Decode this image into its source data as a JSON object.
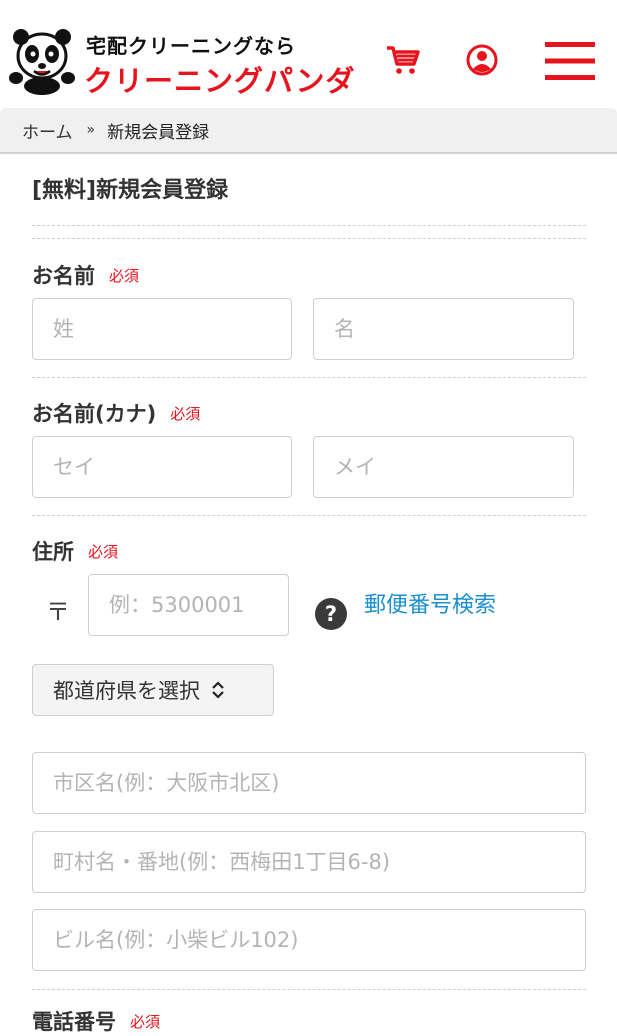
{
  "header": {
    "logo_sub": "宅配クリーニングなら",
    "logo_main": "クリーニングパンダ",
    "brand_color": "#e8141d",
    "icons": {
      "cart": "cart-icon",
      "user": "user-icon",
      "menu": "hamburger-menu-icon"
    }
  },
  "breadcrumb": {
    "home": "ホーム",
    "separator": "»",
    "current": "新規会員登録"
  },
  "form": {
    "title": "[無料]新規会員登録",
    "required_label": "必須",
    "name": {
      "label": "お名前",
      "last_placeholder": "姓",
      "first_placeholder": "名"
    },
    "kana": {
      "label": "お名前(カナ)",
      "last_placeholder": "セイ",
      "first_placeholder": "メイ"
    },
    "address": {
      "label": "住所",
      "postal_mark": "〒",
      "postal_placeholder": "例：5300001",
      "help_icon": "?",
      "zip_search_link": "郵便番号検索",
      "prefecture_select": "都道府県を選択",
      "city_placeholder": "市区名(例：大阪市北区)",
      "town_placeholder": "町村名・番地(例：西梅田1丁目6-8)",
      "building_placeholder": "ビル名(例：小柴ビル102)"
    },
    "phone": {
      "label": "電話番号"
    }
  }
}
